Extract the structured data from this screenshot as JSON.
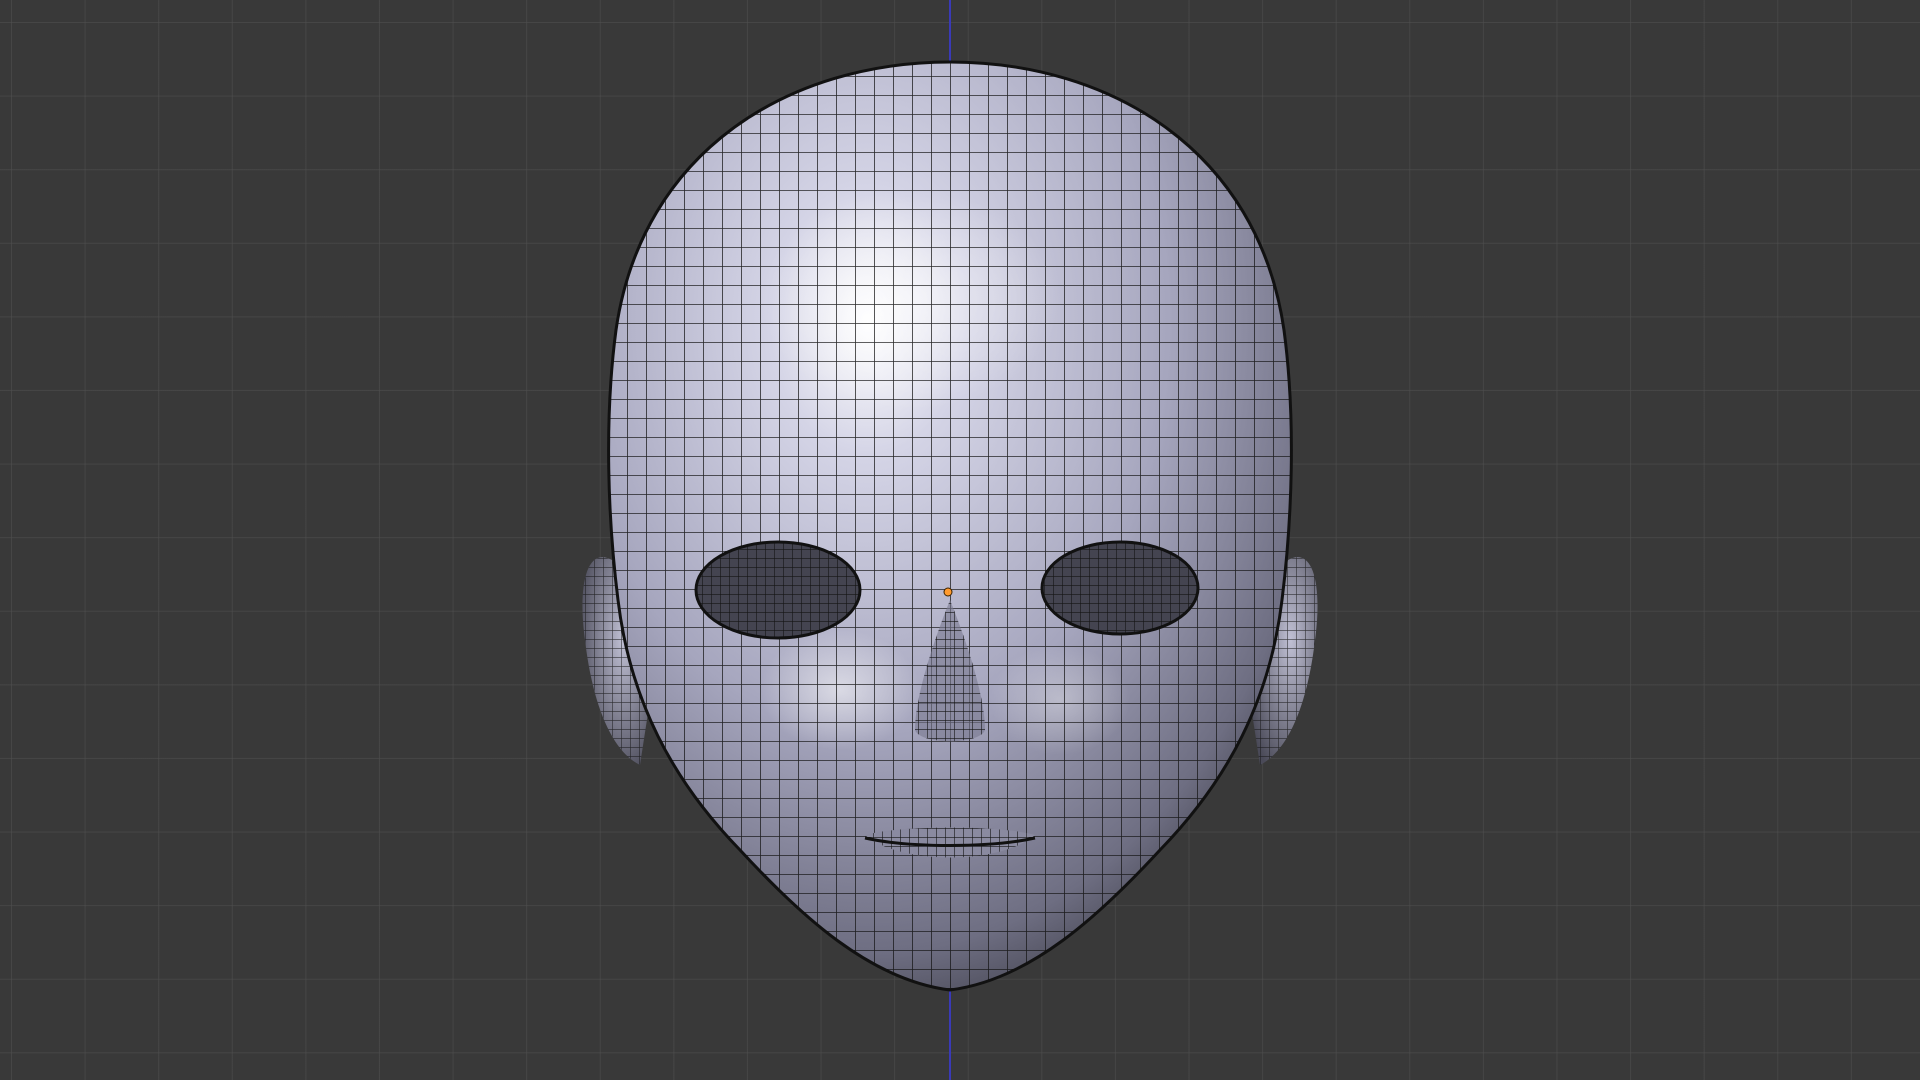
{
  "viewport": {
    "view": "front-orthographic",
    "grid_visible": true,
    "background_color": "#393939",
    "grid_color": "#505050"
  },
  "axis": {
    "name": "z-axis",
    "color": "#3a3ab8"
  },
  "object": {
    "name": "head-mesh",
    "display": "solid-with-wireframe",
    "shading_color": "#a8a8c0",
    "wire_color": "#141414"
  },
  "origin": {
    "name": "object-origin",
    "color": "#ff9a2e"
  },
  "icons": [
    "viewport-grid",
    "origin-dot-icon"
  ]
}
